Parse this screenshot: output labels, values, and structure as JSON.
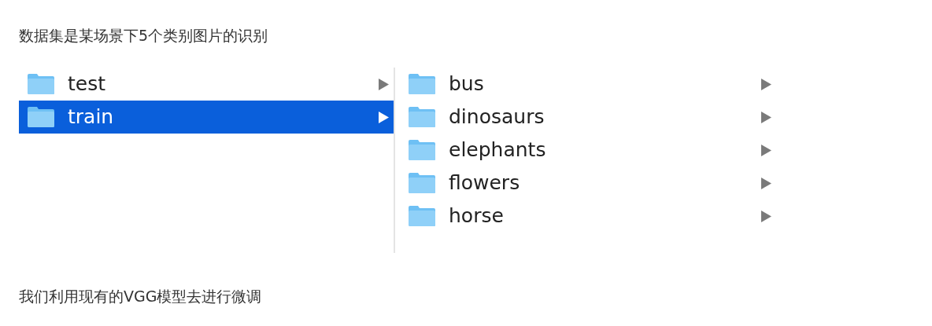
{
  "intro": "数据集是某场景下5个类别图片的识别",
  "columns": [
    {
      "items": [
        {
          "name": "test",
          "selected": false
        },
        {
          "name": "train",
          "selected": true
        }
      ]
    },
    {
      "items": [
        {
          "name": "bus",
          "selected": false
        },
        {
          "name": "dinosaurs",
          "selected": false
        },
        {
          "name": "elephants",
          "selected": false
        },
        {
          "name": "flowers",
          "selected": false
        },
        {
          "name": "horse",
          "selected": false
        }
      ]
    }
  ],
  "footer": "我们利用现有的VGG模型去进行微调"
}
